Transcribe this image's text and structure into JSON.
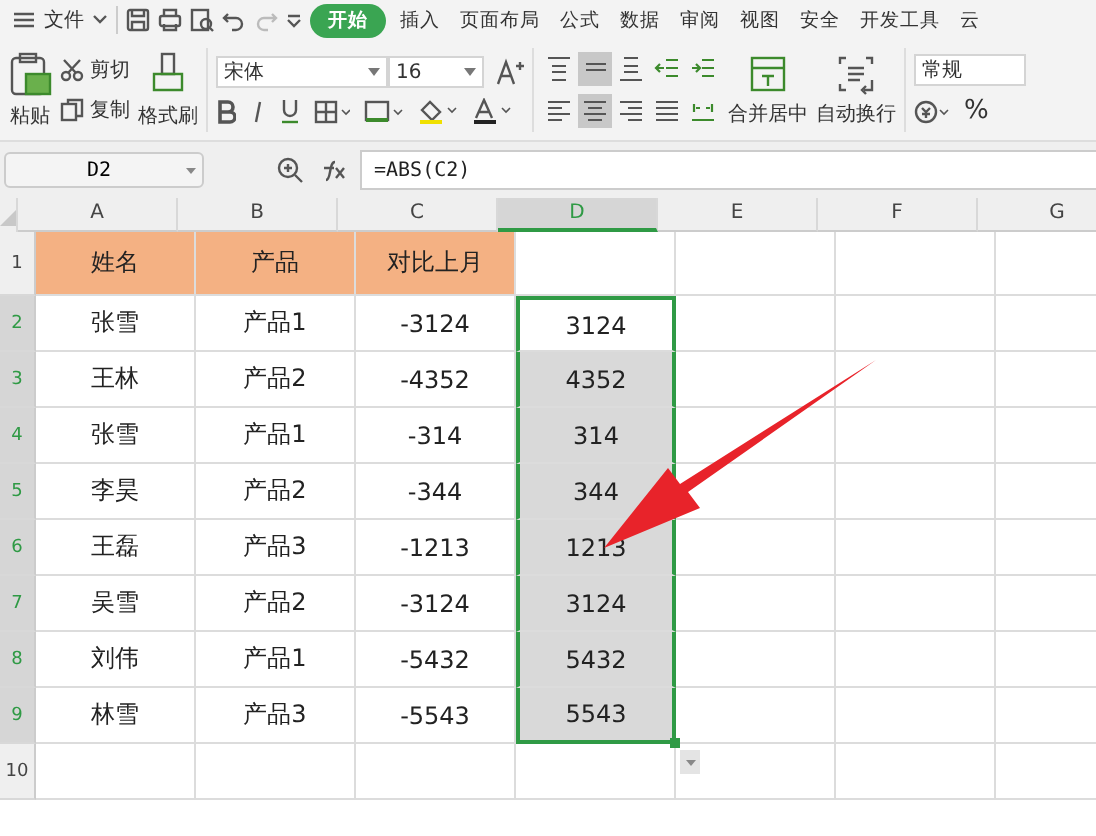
{
  "menu": {
    "file_label": "文件",
    "tabs": [
      {
        "label": "开始",
        "selected": true
      },
      {
        "label": "插入",
        "selected": false
      },
      {
        "label": "页面布局",
        "selected": false
      },
      {
        "label": "公式",
        "selected": false
      },
      {
        "label": "数据",
        "selected": false
      },
      {
        "label": "审阅",
        "selected": false
      },
      {
        "label": "视图",
        "selected": false
      },
      {
        "label": "安全",
        "selected": false
      },
      {
        "label": "开发工具",
        "selected": false
      },
      {
        "label": "云",
        "selected": false
      }
    ]
  },
  "ribbon": {
    "paste": "粘贴",
    "cut": "剪切",
    "copy": "复制",
    "format_painter": "格式刷",
    "font_name": "宋体",
    "font_size": "16",
    "align_top": [
      {
        "kind": "top",
        "selected": false
      },
      {
        "kind": "middle",
        "selected": true
      },
      {
        "kind": "bottom",
        "selected": false
      },
      {
        "kind": "outdent",
        "selected": false
      },
      {
        "kind": "indent",
        "selected": false
      }
    ],
    "align_bottom": [
      {
        "kind": "left",
        "selected": false
      },
      {
        "kind": "center",
        "selected": true
      },
      {
        "kind": "right",
        "selected": false
      },
      {
        "kind": "justify",
        "selected": false
      },
      {
        "kind": "distribute",
        "selected": false
      }
    ],
    "merge": "合并居中",
    "wrap": "自动换行",
    "number_format": "常规",
    "percent": "%"
  },
  "formula_bar": {
    "cell_ref": "D2",
    "formula": "=ABS(C2)"
  },
  "columns": [
    {
      "label": "A",
      "selected": false
    },
    {
      "label": "B",
      "selected": false
    },
    {
      "label": "C",
      "selected": false
    },
    {
      "label": "D",
      "selected": true
    },
    {
      "label": "E",
      "selected": false
    },
    {
      "label": "F",
      "selected": false
    },
    {
      "label": "G",
      "selected": false
    }
  ],
  "rows": [
    {
      "number": "1",
      "kind": "header",
      "selected": false,
      "cells": [
        "姓名",
        "产品",
        "对比上月",
        ""
      ]
    },
    {
      "number": "2",
      "kind": "data",
      "selected": true,
      "cells": [
        "张雪",
        "产品1",
        "-3124",
        "3124"
      ]
    },
    {
      "number": "3",
      "kind": "data",
      "selected": true,
      "cells": [
        "王林",
        "产品2",
        "-4352",
        "4352"
      ]
    },
    {
      "number": "4",
      "kind": "data",
      "selected": true,
      "cells": [
        "张雪",
        "产品1",
        "-314",
        "314"
      ]
    },
    {
      "number": "5",
      "kind": "data",
      "selected": true,
      "cells": [
        "李昊",
        "产品2",
        "-344",
        "344"
      ]
    },
    {
      "number": "6",
      "kind": "data",
      "selected": true,
      "cells": [
        "王磊",
        "产品3",
        "-1213",
        "1213"
      ]
    },
    {
      "number": "7",
      "kind": "data",
      "selected": true,
      "cells": [
        "吴雪",
        "产品2",
        "-3124",
        "3124"
      ]
    },
    {
      "number": "8",
      "kind": "data",
      "selected": true,
      "cells": [
        "刘伟",
        "产品1",
        "-5432",
        "5432"
      ]
    },
    {
      "number": "9",
      "kind": "data",
      "selected": true,
      "cells": [
        "林雪",
        "产品3",
        "-5543",
        "5543"
      ]
    },
    {
      "number": "10",
      "kind": "data",
      "selected": false,
      "cells": []
    }
  ]
}
